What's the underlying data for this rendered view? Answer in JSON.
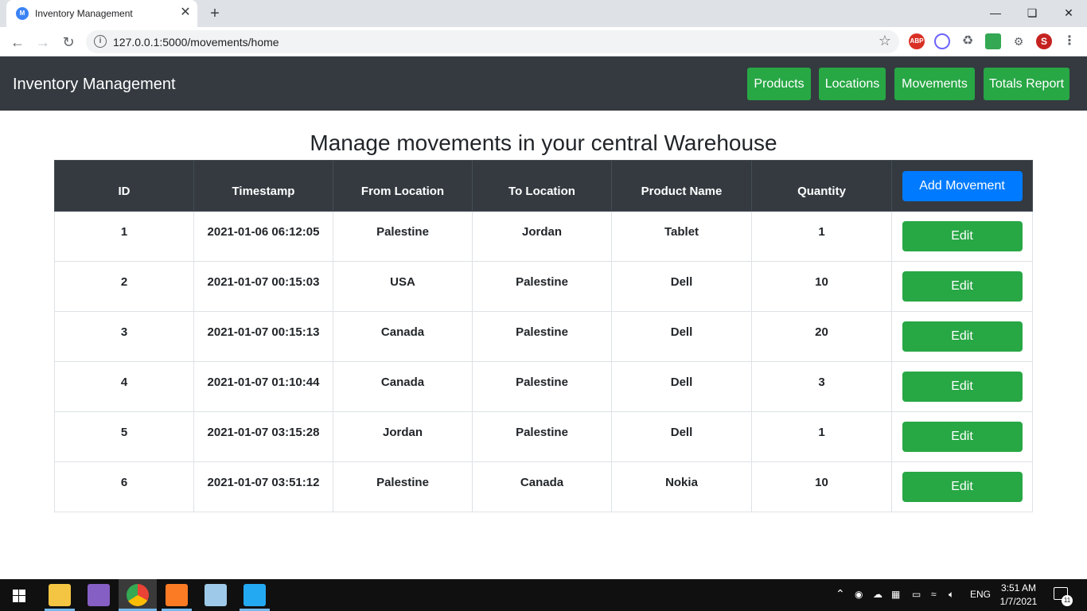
{
  "browser": {
    "tab_title": "Inventory Management",
    "tab_close": "✕",
    "new_tab": "+",
    "url": "127.0.0.1:5000/movements/home"
  },
  "navbar": {
    "brand": "Inventory Management",
    "links": [
      "Products",
      "Locations",
      "Movements",
      "Totals Report"
    ]
  },
  "page": {
    "title": "Manage movements in your central Warehouse"
  },
  "table": {
    "headers": [
      "ID",
      "Timestamp",
      "From Location",
      "To Location",
      "Product Name",
      "Quantity"
    ],
    "add_button": "Add Movement",
    "edit_label": "Edit",
    "rows": [
      {
        "id": "1",
        "timestamp": "2021-01-06 06:12:05",
        "from": "Palestine",
        "to": "Jordan",
        "product": "Tablet",
        "qty": "1"
      },
      {
        "id": "2",
        "timestamp": "2021-01-07 00:15:03",
        "from": "USA",
        "to": "Palestine",
        "product": "Dell",
        "qty": "10"
      },
      {
        "id": "3",
        "timestamp": "2021-01-07 00:15:13",
        "from": "Canada",
        "to": "Palestine",
        "product": "Dell",
        "qty": "20"
      },
      {
        "id": "4",
        "timestamp": "2021-01-07 01:10:44",
        "from": "Canada",
        "to": "Palestine",
        "product": "Dell",
        "qty": "3"
      },
      {
        "id": "5",
        "timestamp": "2021-01-07 03:15:28",
        "from": "Jordan",
        "to": "Palestine",
        "product": "Dell",
        "qty": "1"
      },
      {
        "id": "6",
        "timestamp": "2021-01-07 03:51:12",
        "from": "Palestine",
        "to": "Canada",
        "product": "Nokia",
        "qty": "10"
      }
    ]
  },
  "taskbar": {
    "language": "ENG",
    "time": "3:51 AM",
    "date": "1/7/2021",
    "notification_count": "11"
  },
  "colors": {
    "navbar_bg": "#343a40",
    "success": "#28a745",
    "primary": "#007bff"
  }
}
